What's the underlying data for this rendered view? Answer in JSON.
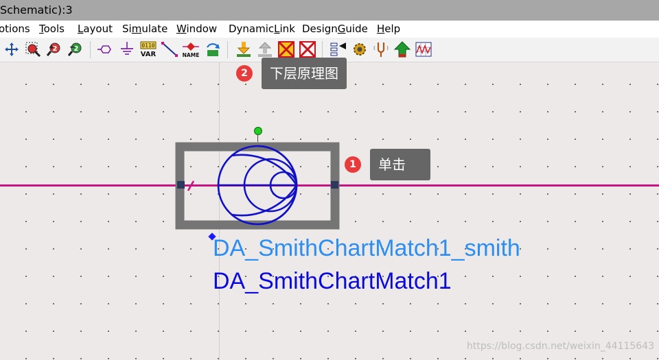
{
  "window": {
    "title": "Schematic):3"
  },
  "menu": {
    "items": [
      {
        "id": "options",
        "pre": "",
        "ul": "",
        "post": "otions"
      },
      {
        "id": "tools",
        "pre": "",
        "ul": "T",
        "post": "ools"
      },
      {
        "id": "layout",
        "pre": "",
        "ul": "L",
        "post": "ayout"
      },
      {
        "id": "simulate",
        "pre": "Si",
        "ul": "m",
        "post": "ulate"
      },
      {
        "id": "window",
        "pre": "",
        "ul": "W",
        "post": "indow"
      },
      {
        "id": "dynamiclink",
        "pre": "Dynamic",
        "ul": "L",
        "post": "ink"
      },
      {
        "id": "designguide",
        "pre": "Design",
        "ul": "G",
        "post": "uide"
      },
      {
        "id": "help",
        "pre": "",
        "ul": "H",
        "post": "elp"
      }
    ]
  },
  "toolbar": {
    "var_label_top": "0110",
    "var_label_bottom": "VAR",
    "name_label": "NAME"
  },
  "tooltips": {
    "push_into_hierarchy": {
      "badge": "2",
      "text": "下层原理图"
    },
    "single_click": {
      "badge": "1",
      "text": "单击"
    }
  },
  "component": {
    "instance_name": "DA_SmithChartMatch1_smith",
    "design_name": "DA_SmithChartMatch1"
  },
  "colors": {
    "wire": "#c7127f",
    "component_frame": "#757575",
    "smith_chart": "#1010c8",
    "port": "#2b3a5c",
    "instance_text": "#2a8ef3",
    "design_text": "#0a0ae0",
    "tooltip_bg": "#666666",
    "badge": "#e83b3b"
  },
  "watermark": "https://blog.csdn.net/weixin_44115643"
}
